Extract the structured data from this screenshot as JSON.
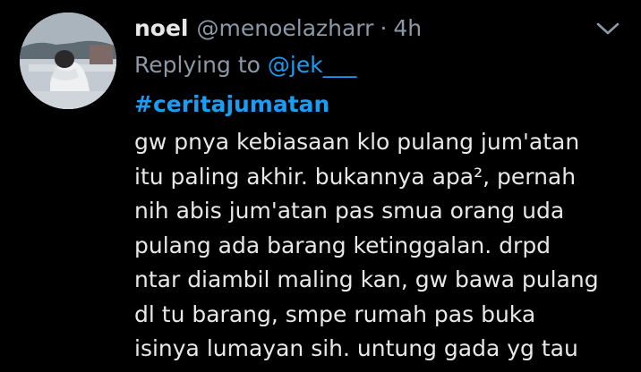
{
  "tweet": {
    "display_name": "noel",
    "handle": "@menoelazharr",
    "separator": "·",
    "time": "4h",
    "replying_prefix": "Replying to ",
    "replying_to": "@jek___",
    "hashtag": "#ceritajumatan",
    "lines": [
      "gw pnya kebiasaan klo pulang jum'atan",
      "itu paling akhir. bukannya apa², pernah",
      "nih abis jum'atan pas smua orang uda",
      "pulang ada barang ketinggalan. drpd",
      "ntar diambil maling kan, gw bawa pulang",
      "dl tu barang, smpe rumah pas buka",
      "isinya lumayan sih. untung gada yg tau"
    ]
  },
  "icons": {
    "more": "chevron-down-icon",
    "avatar": "profile-photo"
  },
  "colors": {
    "background": "#000000",
    "text": "#e8e8e8",
    "muted": "#8b98a5",
    "link": "#1d9bf0"
  }
}
